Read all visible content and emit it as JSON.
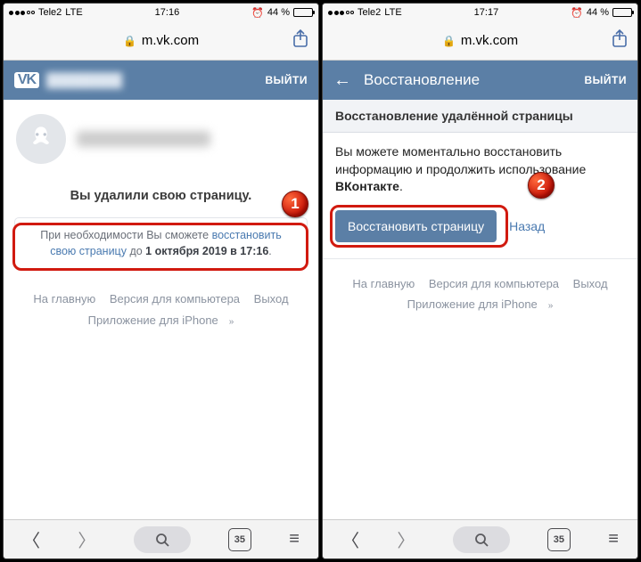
{
  "status": {
    "carrier": "Tele2",
    "network": "LTE",
    "time_left": "17:16",
    "time_right": "17:17",
    "alarm": "⏰",
    "battery_pct": "44 %"
  },
  "browser": {
    "url": "m.vk.com",
    "tabs_count": "35"
  },
  "vk": {
    "logo_text": "VK",
    "exit": "ВЫЙТИ",
    "restore_title": "Восстановление",
    "sub_header": "Восстановление удалённой страницы"
  },
  "left": {
    "deleted_msg": "Вы удалили свою страницу.",
    "info_prefix": "При необходимости Вы сможете ",
    "info_link": "восстановить свою страницу",
    "info_mid": " до ",
    "info_bold": "1 октября 2019 в 17:16",
    "info_suffix": "."
  },
  "right": {
    "restore_text_1": "Вы можете моментально восстановить информацию и продолжить использование ",
    "restore_text_bold": "ВКонтакте",
    "restore_text_2": ".",
    "restore_btn": "Восстановить страницу",
    "back_link": "Назад"
  },
  "footer": {
    "home": "На главную",
    "desktop": "Версия для компьютера",
    "logout": "Выход",
    "iphone_app": "Приложение для iPhone"
  },
  "badges": {
    "one": "1",
    "two": "2"
  }
}
